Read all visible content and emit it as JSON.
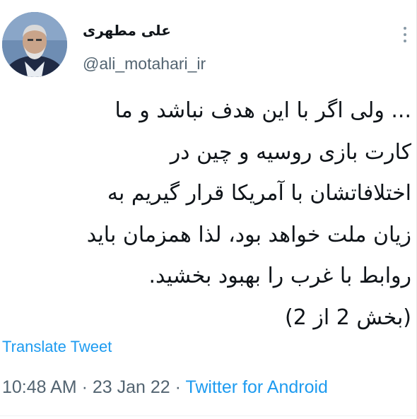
{
  "author": {
    "display_name": "علی مطهری",
    "handle": "@ali_motahari_ir"
  },
  "tweet": {
    "lines": [
      "... ولی اگر با این هدف نباشد و ما",
      "کارت بازی روسیه و چین در",
      "اختلافاتشان با آمریکا قرار گیریم به",
      "زیان ملت خواهد بود، لذا همزمان باید",
      "روابط با غرب را بهبود بخشید.",
      "(بخش 2 از 2)"
    ],
    "translate_label": "Translate Tweet"
  },
  "meta": {
    "time": "10:48 AM",
    "separator": "·",
    "date": "23 Jan 22",
    "source": "Twitter for Android"
  },
  "icons": {
    "more": "more-vertical-icon",
    "avatar": "profile-photo"
  },
  "colors": {
    "link": "#1d9bf0",
    "secondary_text": "#536471",
    "primary_text": "#0f1419"
  }
}
